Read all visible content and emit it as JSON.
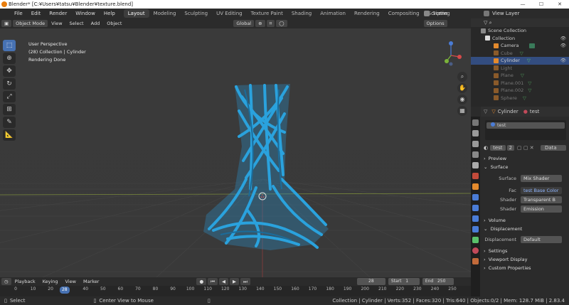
{
  "titlebar": {
    "title": "Blender* [C:¥Users¥tatsu¥Blender¥texture.blend]"
  },
  "menu": [
    "File",
    "Edit",
    "Render",
    "Window",
    "Help"
  ],
  "workspaces": [
    "Layout",
    "Modeling",
    "Sculpting",
    "UV Editing",
    "Texture Paint",
    "Shading",
    "Animation",
    "Rendering",
    "Compositing",
    "Scripting"
  ],
  "scene": {
    "label": "Scene",
    "view_layer": "View Layer"
  },
  "viewport": {
    "mode": "Object Mode",
    "menus": [
      "View",
      "Select",
      "Add",
      "Object"
    ],
    "transform": "Global",
    "options": "Options",
    "overlay_lines": [
      "User Perspective",
      "(28) Collection | Cylinder",
      "Rendering Done"
    ]
  },
  "timeline": {
    "menus": [
      "Playback",
      "Keying",
      "View",
      "Marker"
    ],
    "current_frame": "28",
    "current_field": "28",
    "start_label": "Start",
    "start": "1",
    "end_label": "End",
    "end": "250",
    "ticks": [
      "0",
      "10",
      "20",
      "40",
      "50",
      "60",
      "70",
      "80",
      "90",
      "100",
      "110",
      "120",
      "130",
      "140",
      "150",
      "160",
      "170",
      "180",
      "190",
      "200",
      "210",
      "220",
      "230",
      "240",
      "250"
    ]
  },
  "status": {
    "select": "Select",
    "center": "Center View to Mouse",
    "stats": "Collection | Cylinder | Verts:352 | Faces:320 | Tris:640 | Objects:0/2 | Mem: 128.7 MiB | 2.83.4"
  },
  "outliner": {
    "root": "Scene Collection",
    "collection": "Collection",
    "items": [
      "Camera",
      "Cube",
      "Cylinder",
      "Light",
      "Plane",
      "Plane.001",
      "Plane.002",
      "Sphere"
    ]
  },
  "properties": {
    "object": "Cylinder",
    "material": "test",
    "slot": "test",
    "mat_name": "test",
    "users": "2",
    "data": "Data",
    "sections": {
      "preview": "Preview",
      "surface": "Surface",
      "volume": "Volume",
      "displacement": "Displacement",
      "settings": "Settings",
      "viewport_display": "Viewport Display",
      "custom_props": "Custom Properties"
    },
    "rows": {
      "surface_l": "Surface",
      "surface_v": "Mix Shader",
      "fac_l": "Fac",
      "fac_v": "test Base Color",
      "shader1_l": "Shader",
      "shader1_v": "Transparent B",
      "shader2_l": "Shader",
      "shader2_v": "Emission",
      "disp_l": "Displacement",
      "disp_v": "Default"
    }
  },
  "colors": {
    "accent": "#4772b3",
    "mesh": "#2aa2dd"
  }
}
